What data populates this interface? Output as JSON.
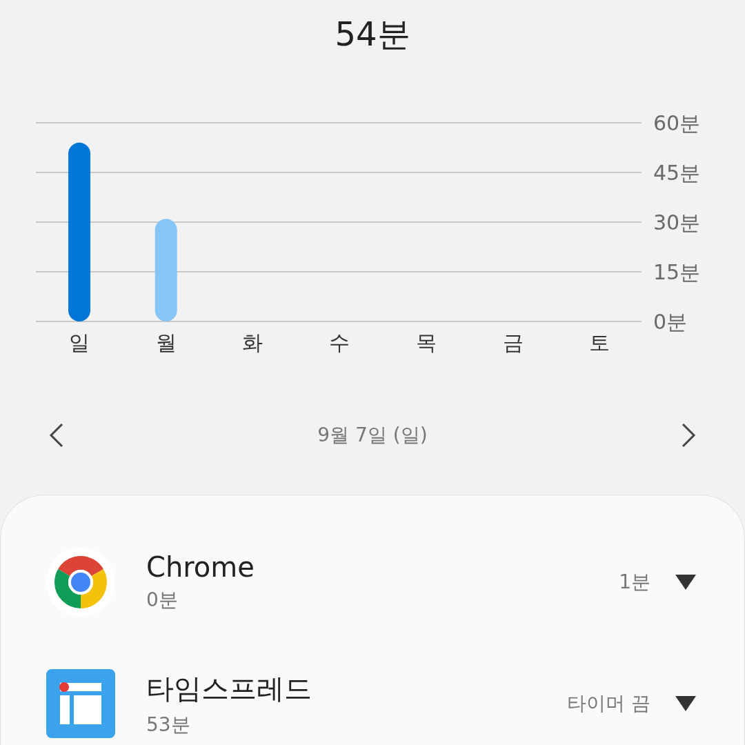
{
  "total": "54분",
  "chart": {
    "chart_data": {
      "type": "bar",
      "stacked": true,
      "grid": true,
      "categories": [
        "일",
        "월",
        "화",
        "수",
        "목",
        "금",
        "토"
      ],
      "series": [
        {
          "color": "#0077d6",
          "values": [
            54,
            null,
            null,
            null,
            null,
            null,
            null
          ]
        },
        {
          "color": "#86c5f7",
          "values": [
            null,
            31,
            0,
            0,
            0,
            0,
            0
          ]
        }
      ],
      "ylim": [
        0,
        60
      ],
      "yticks": [
        {
          "value": 0,
          "label": "0분"
        },
        {
          "value": 15,
          "label": "15분"
        },
        {
          "value": 30,
          "label": "30분"
        },
        {
          "value": 45,
          "label": "45분"
        },
        {
          "value": 60,
          "label": "60분"
        }
      ]
    }
  },
  "day_nav": {
    "label": "9월 7일 (일)"
  },
  "apps": [
    {
      "kind": "chrome",
      "name": "Chrome",
      "usage": "0분",
      "limit": "1분"
    },
    {
      "kind": "timespread",
      "name": "타임스프레드",
      "usage": "53분",
      "limit": "타이머 끔"
    }
  ]
}
